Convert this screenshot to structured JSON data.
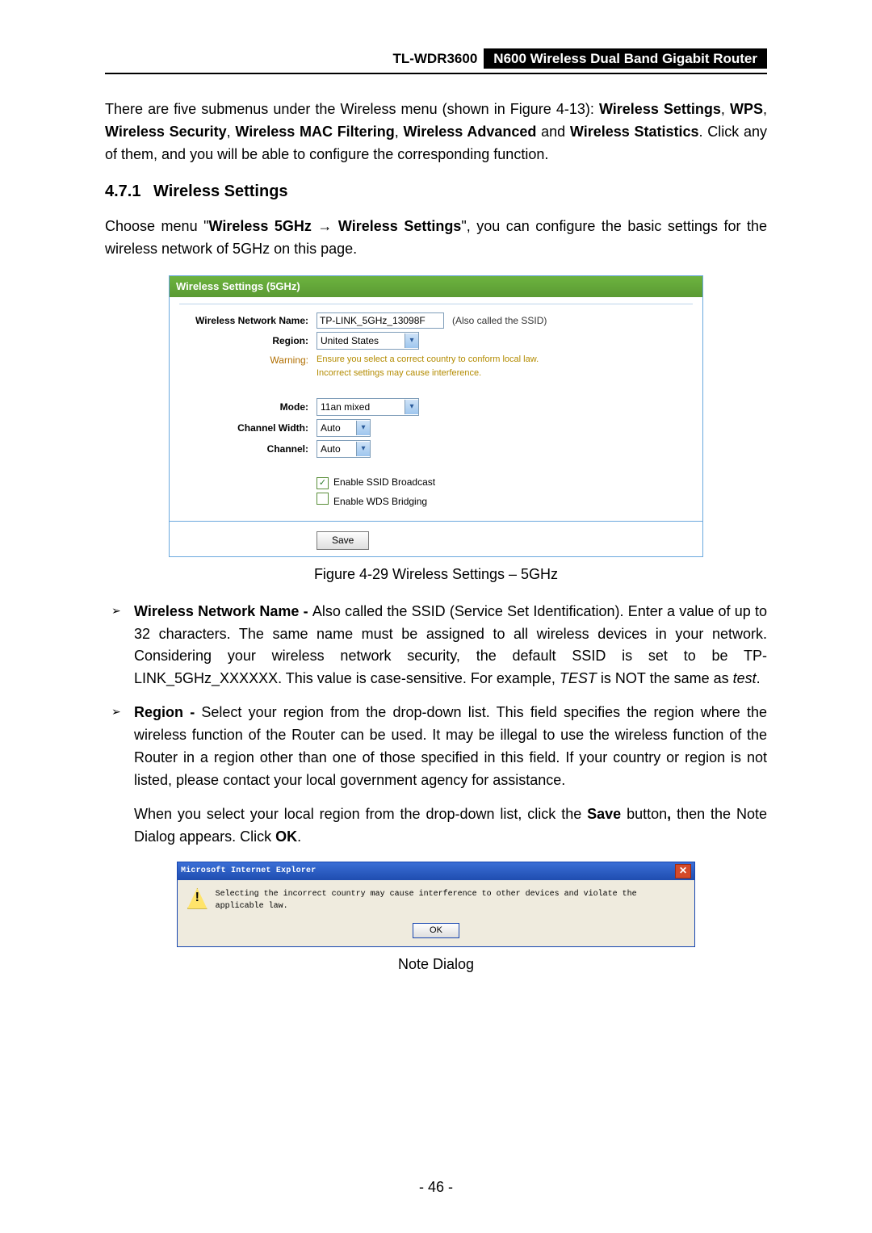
{
  "header": {
    "model": "TL-WDR3600",
    "product": "N600 Wireless Dual Band Gigabit Router"
  },
  "para1_a": "There are five submenus under the Wireless menu (shown in Figure 4-13): ",
  "para1_b": "Wireless Settings",
  "para1_c": ", ",
  "para1_d": "WPS",
  "para1_e": ", ",
  "para1_f": "Wireless Security",
  "para1_g": ", ",
  "para1_h": "Wireless MAC Filtering",
  "para1_i": ", ",
  "para1_j": "Wireless Advanced",
  "para1_k": " and ",
  "para1_l": "Wireless Statistics",
  "para1_m": ". Click any of them, and you will be able to configure the corresponding function.",
  "section_num": "4.7.1",
  "section_title": "Wireless Settings",
  "para2_a": "Choose menu \"",
  "para2_b": "Wireless 5GHz",
  "para2_c": " → ",
  "para2_d": "Wireless Settings",
  "para2_e": "\", you can configure the basic settings for the wireless network of 5GHz on this page.",
  "panel": {
    "title": "Wireless Settings (5GHz)",
    "name_label": "Wireless Network Name:",
    "name_value": "TP-LINK_5GHz_13098F",
    "name_aside": "(Also called the SSID)",
    "region_label": "Region:",
    "region_value": "United States",
    "warning_label": "Warning:",
    "warning_text1": "Ensure you select a correct country to conform local law.",
    "warning_text2": "Incorrect settings may cause interference.",
    "mode_label": "Mode:",
    "mode_value": "11an mixed",
    "chwidth_label": "Channel Width:",
    "chwidth_value": "Auto",
    "channel_label": "Channel:",
    "channel_value": "Auto",
    "ssid_chk": "Enable SSID Broadcast",
    "wds_chk": "Enable WDS Bridging",
    "save": "Save"
  },
  "fig_caption": "Figure 4-29 Wireless Settings – 5GHz",
  "bullet1_a": "Wireless Network Name - ",
  "bullet1_b": "Also called the SSID (Service Set Identification). Enter a value of up to 32 characters. The same name must be assigned to all wireless devices in your network. Considering your wireless network security, the default SSID is set to be TP-LINK_5GHz_XXXXXX. This value is case-sensitive. For example, ",
  "bullet1_c": "TEST",
  "bullet1_d": " is NOT the same as ",
  "bullet1_e": "test",
  "bullet1_f": ".",
  "bullet2_a": "Region - ",
  "bullet2_b": "Select your region from the drop-down list. This field specifies the region where the wireless function of the Router can be used. It may be illegal to use the wireless function of the Router in a region other than one of those specified in this field. If your country or region is not listed, please contact your local government agency for assistance.",
  "para3_a": "When you select your local region from the drop-down list, click the ",
  "para3_b": "Save",
  "para3_c": " button",
  "para3_d": ", ",
  "para3_e": "then the Note Dialog appears. Click ",
  "para3_f": "OK",
  "para3_g": ".",
  "dialog": {
    "title": "Microsoft Internet Explorer",
    "msg": "Selecting the incorrect country may cause interference to other devices and violate the applicable law.",
    "ok": "OK"
  },
  "note_caption": "Note Dialog",
  "page_number": "- 46 -"
}
